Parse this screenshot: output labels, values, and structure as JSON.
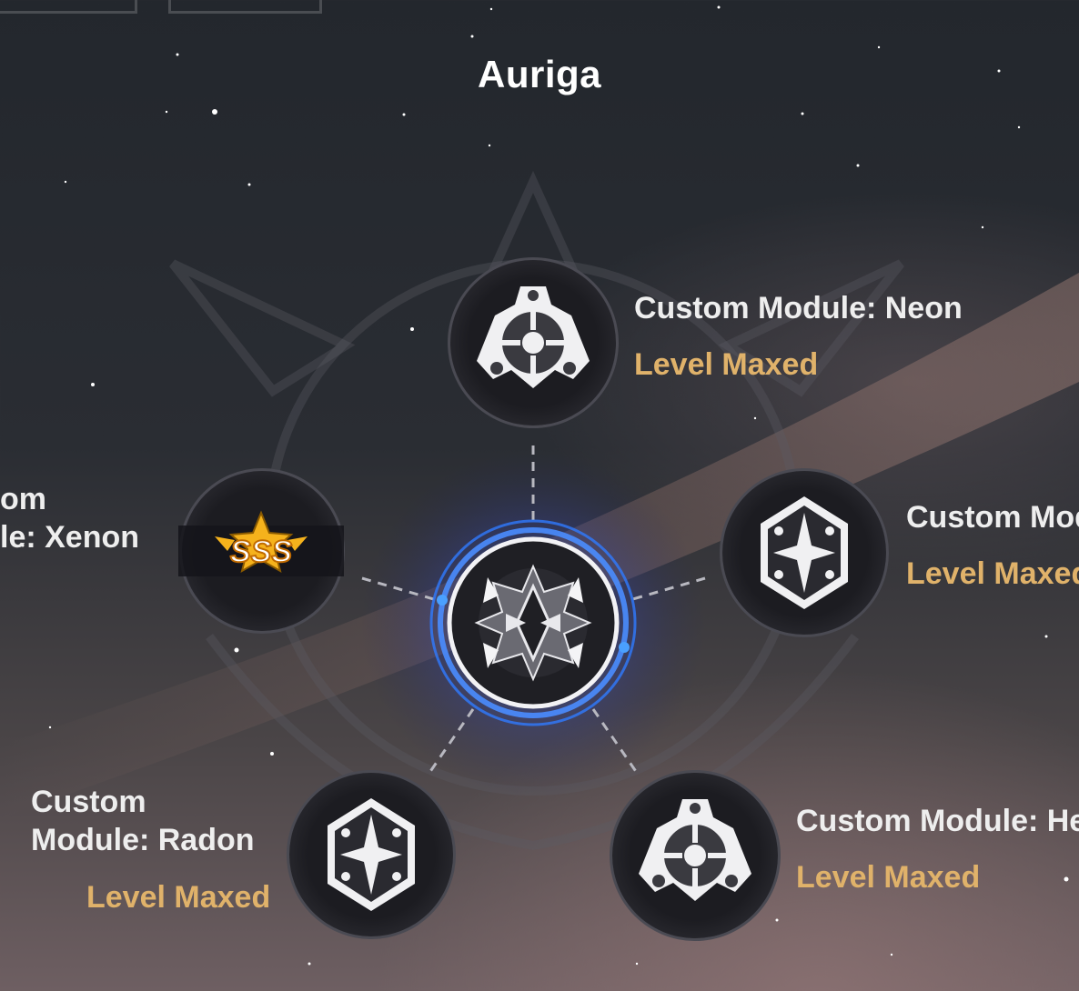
{
  "title": "Auriga",
  "modules": {
    "neon": {
      "name": "Custom Module: Neon",
      "status": "Level Maxed",
      "icon": "gear-shield-icon"
    },
    "xenon": {
      "name_line1": "om",
      "name_line2": "le: Xenon",
      "badge": "SSS",
      "icon": "sss-rank-badge-icon"
    },
    "right": {
      "name": "Custom Mod",
      "status": "Level Maxed",
      "icon": "star-hexagon-icon"
    },
    "radon": {
      "name_line1": "Custom",
      "name_line2": "Module: Radon",
      "status": "Level Maxed",
      "icon": "star-hexagon-icon"
    },
    "helium": {
      "name": "Custom Module: He",
      "status": "Level Maxed",
      "icon": "gear-shield-icon"
    }
  },
  "center": {
    "icon": "auriga-core-emblem-icon"
  },
  "colors": {
    "status": "#e0b26a",
    "accent_blue": "#2f7bff",
    "node_ring": "#7a7a84",
    "badge_gold": "#f5b21c"
  }
}
